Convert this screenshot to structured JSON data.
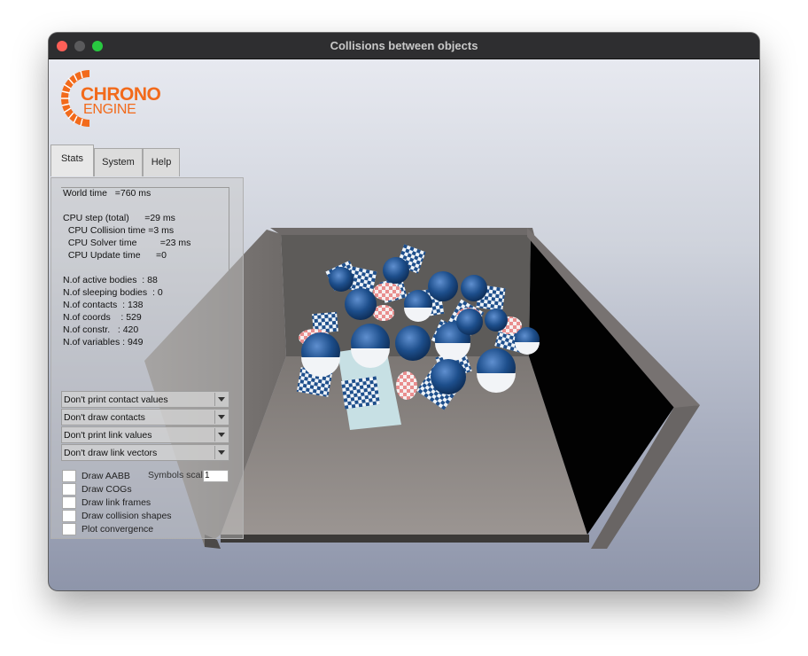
{
  "window": {
    "title": "Collisions between objects"
  },
  "logo": {
    "line1": "CHRONO",
    "line2": "ENGINE",
    "color": "#f26a1b"
  },
  "tabs": [
    {
      "label": "Stats",
      "active": true
    },
    {
      "label": "System",
      "active": false
    },
    {
      "label": "Help",
      "active": false
    }
  ],
  "stats": {
    "world_time": "World time   =760 ms",
    "cpu_step": "CPU step (total)      =29 ms",
    "cpu_collision": "  CPU Collision time =3 ms",
    "cpu_solver": "  CPU Solver time         =23 ms",
    "cpu_update": "  CPU Update time      =0",
    "active_bodies": "N.of active bodies  : 88",
    "sleeping_bodies": "N.of sleeping bodies  : 0",
    "contacts": "N.of contacts  : 138",
    "coords": "N.of coords    : 529",
    "constr": "N.of constr.   : 420",
    "variables": "N.of variables : 949"
  },
  "dropdowns": {
    "contact_values": "Don't print contact values",
    "contacts": "Don't draw contacts",
    "link_values": "Don't print link values",
    "link_vectors": "Don't draw link vectors"
  },
  "checkboxes": {
    "draw_aabb": "Draw AABB",
    "draw_cogs": "Draw COGs",
    "draw_link_frames": "Draw link frames",
    "draw_collision_shapes": "Draw collision shapes",
    "plot_convergence": "Plot convergence"
  },
  "symbols": {
    "label": "Symbols scale",
    "value": "1"
  },
  "colors": {
    "close": "#fe5f57",
    "minimize": "#5a5a5c",
    "maximize": "#28c840",
    "body_blue": "#1e4f8c"
  }
}
